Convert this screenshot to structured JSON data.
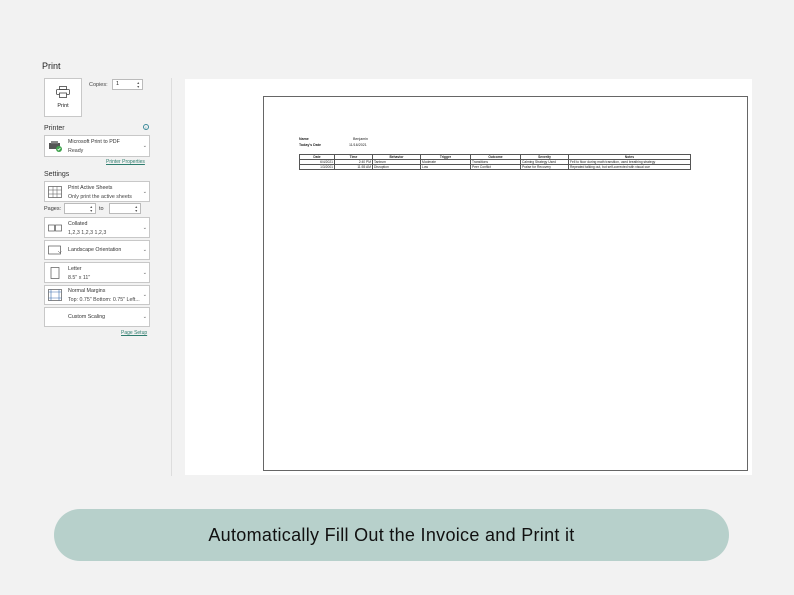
{
  "header": {
    "title": "Print"
  },
  "print_button": {
    "label": "Print",
    "icon": "printer-icon"
  },
  "copies": {
    "label": "Copies:",
    "value": "1"
  },
  "printer": {
    "section": "Printer",
    "name": "Microsoft Print to PDF",
    "status": "Ready",
    "properties_link": "Printer Properties"
  },
  "settings": {
    "section": "Settings",
    "sheets": {
      "line1": "Print Active Sheets",
      "line2": "Only print the active sheets"
    },
    "pages_label": "Pages:",
    "to_label": "to",
    "collated": {
      "line1": "Collated",
      "line2": "1,2,3    1,2,3    1,2,3"
    },
    "orientation": {
      "line1": "Landscape Orientation"
    },
    "paper": {
      "line1": "Letter",
      "line2": "8.5\" x 11\""
    },
    "margins": {
      "line1": "Normal Margins",
      "line2": "Top: 0.75\" Bottom: 0.75\" Left..."
    },
    "scaling": {
      "line1": "Custom Scaling"
    },
    "page_setup_link": "Page Setup"
  },
  "preview": {
    "name_label": "Name",
    "name_value": "Benjamin",
    "date_label": "Today's Date",
    "date_value": "11/16/2021",
    "columns": [
      "Date",
      "Time",
      "Behavior",
      "Trigger",
      "Outcome",
      "Severity",
      "Notes"
    ],
    "rows": [
      [
        "6/4/2021",
        "2:40 PM",
        "Tantrum",
        "Moderate",
        "Transitions",
        "Calming Strategy Used",
        "Fell to floor during math transition, used breathing strategy"
      ],
      [
        "1/3/2001",
        "11:55 AM",
        "Disruption",
        "Low",
        "Peer Conflict",
        "Praise for Recovery",
        "Repeated talking out, but self-corrected with visual cue"
      ]
    ]
  },
  "banner": {
    "text": "Automatically Fill Out the Invoice and Print it"
  },
  "colors": {
    "banner_bg": "#b7d0cb",
    "link": "#2e7d6e",
    "background": "#f2f2f2"
  }
}
